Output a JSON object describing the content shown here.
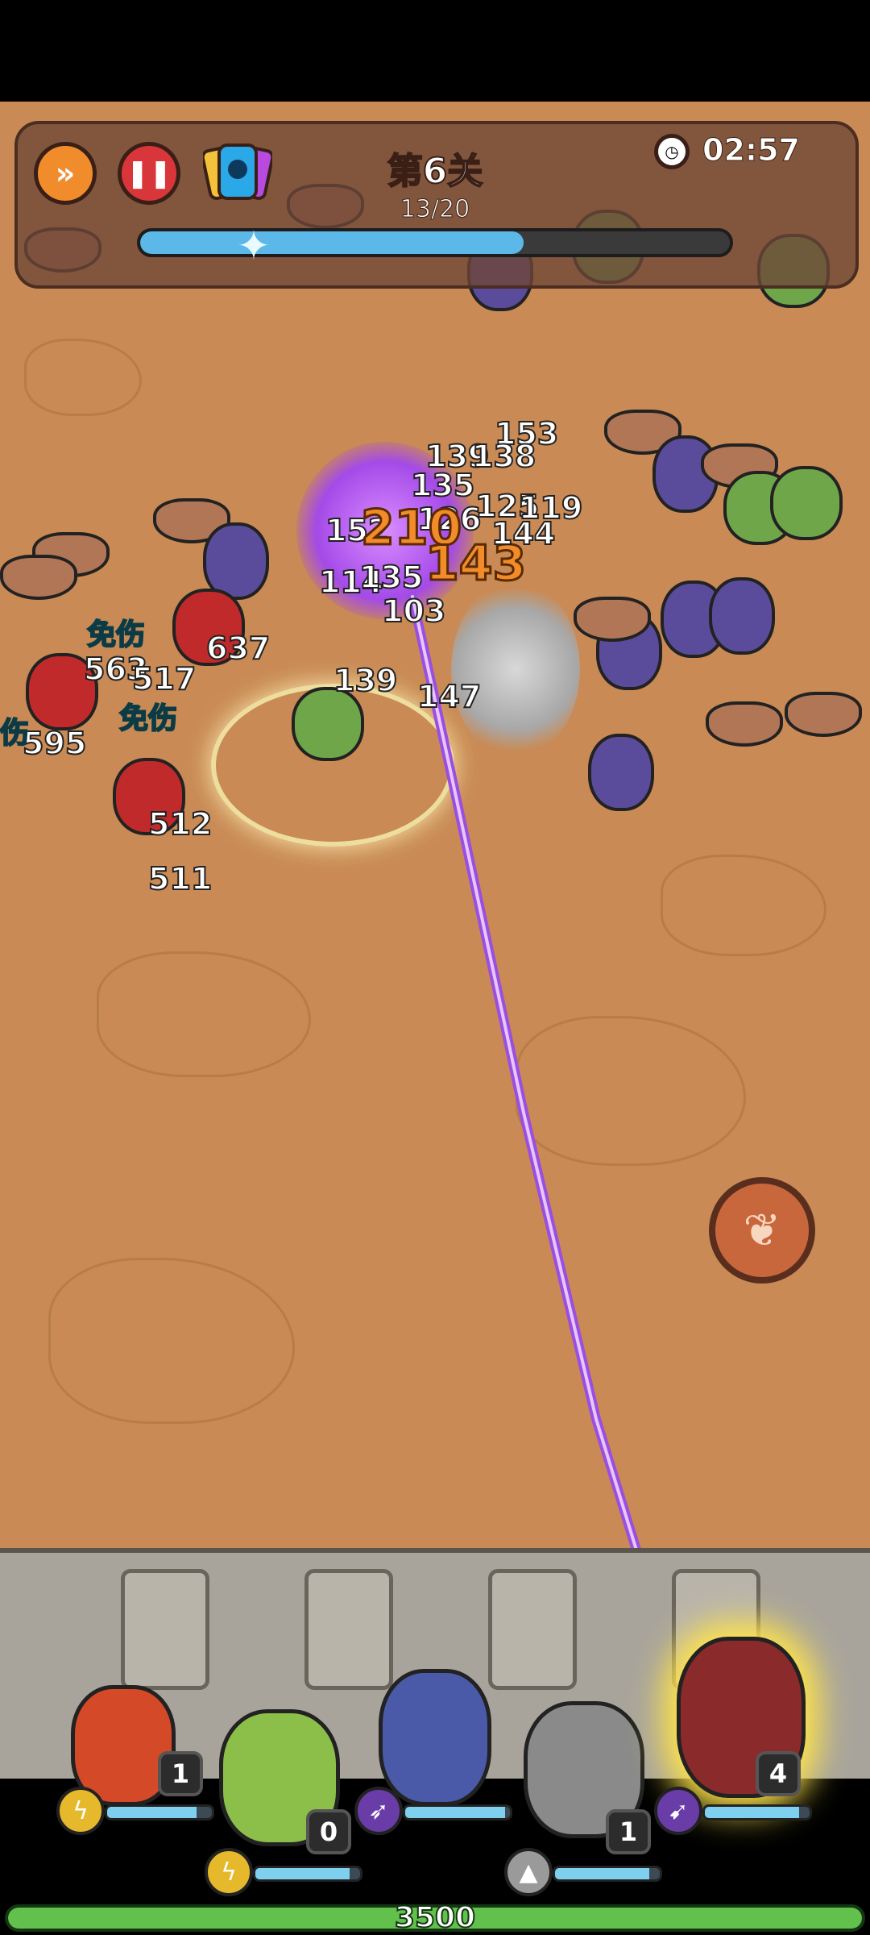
{
  "hud": {
    "fast_forward_icon": "double-chevron-right",
    "pause_icon": "pause",
    "skin_icon": "character-card",
    "level_title": "第6关",
    "wave_progress_text": "13/20",
    "wave_progress_fraction": 0.65,
    "timer_icon": "clock",
    "timer_text": "02:57"
  },
  "damage_numbers": [
    {
      "text": "153"
    },
    {
      "text": "139"
    },
    {
      "text": "138"
    },
    {
      "text": "135"
    },
    {
      "text": "126"
    },
    {
      "text": "125"
    },
    {
      "text": "119"
    },
    {
      "text": "152"
    },
    {
      "text": "210"
    },
    {
      "text": "143"
    },
    {
      "text": "144"
    },
    {
      "text": "114"
    },
    {
      "text": "135"
    },
    {
      "text": "103"
    },
    {
      "text": "637"
    },
    {
      "text": "563"
    },
    {
      "text": "517"
    },
    {
      "text": "595"
    },
    {
      "text": "139"
    },
    {
      "text": "147"
    },
    {
      "text": "512"
    },
    {
      "text": "511"
    }
  ],
  "immune_labels": [
    "免伤",
    "免伤",
    "伤"
  ],
  "skill": {
    "icon": "phoenix"
  },
  "heroes": [
    {
      "name": "knight",
      "level": "1",
      "hp_fraction": 0.85,
      "skill_icon": "lightning",
      "colors": "#d44a28"
    },
    {
      "name": "goblin-hammer",
      "level": "0",
      "hp_fraction": 0.9,
      "skill_icon": "lightning-bolts",
      "colors": "#8cbf4a"
    },
    {
      "name": "dark-elf",
      "level": "",
      "hp_fraction": 0.95,
      "skill_icon": "arrows",
      "colors": "#4a5aa8"
    },
    {
      "name": "stone-golem",
      "level": "1",
      "hp_fraction": 0.9,
      "skill_icon": "rock",
      "colors": "#8a8a8a"
    },
    {
      "name": "archer-girl",
      "level": "4",
      "hp_fraction": 0.9,
      "skill_icon": "bow",
      "colors": "#8a2a2a"
    }
  ],
  "base_hp": {
    "text": "3500",
    "fraction": 1.0
  },
  "colors": {
    "field": "#c98a55",
    "accent_purple": "#a44ae8",
    "hp_green": "#62c04d",
    "mana_blue": "#7fd0ef"
  }
}
